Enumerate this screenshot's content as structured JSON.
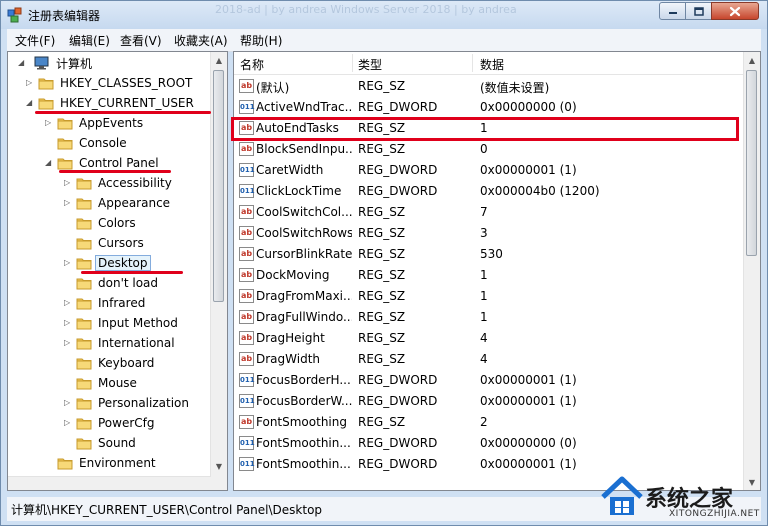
{
  "window": {
    "title": "注册表编辑器",
    "ghost_tab_text": "2018-ad | by andrea                                    Windows Server 2018 | by andrea"
  },
  "menu": [
    "文件(F)",
    "编辑(E)",
    "查看(V)",
    "收藏夹(A)",
    "帮助(H)"
  ],
  "tree": {
    "root": "计算机",
    "items": [
      {
        "label": "HKEY_CLASSES_ROOT",
        "expander": "▷"
      },
      {
        "label": "HKEY_CURRENT_USER",
        "expander": "◢"
      },
      {
        "label": "AppEvents",
        "expander": "▷"
      },
      {
        "label": "Console",
        "expander": ""
      },
      {
        "label": "Control Panel",
        "expander": "◢"
      },
      {
        "label": "Accessibility",
        "expander": "▷"
      },
      {
        "label": "Appearance",
        "expander": "▷"
      },
      {
        "label": "Colors",
        "expander": ""
      },
      {
        "label": "Cursors",
        "expander": ""
      },
      {
        "label": "Desktop",
        "expander": "▷"
      },
      {
        "label": "don't load",
        "expander": ""
      },
      {
        "label": "Infrared",
        "expander": "▷"
      },
      {
        "label": "Input Method",
        "expander": "▷"
      },
      {
        "label": "International",
        "expander": "▷"
      },
      {
        "label": "Keyboard",
        "expander": ""
      },
      {
        "label": "Mouse",
        "expander": ""
      },
      {
        "label": "Personalization",
        "expander": "▷"
      },
      {
        "label": "PowerCfg",
        "expander": "▷"
      },
      {
        "label": "Sound",
        "expander": ""
      },
      {
        "label": "Environment",
        "expander": ""
      }
    ]
  },
  "list": {
    "columns": [
      "名称",
      "类型",
      "数据"
    ],
    "rows": [
      {
        "icon": "ab",
        "name": "(默认)",
        "type": "REG_SZ",
        "data": "(数值未设置)"
      },
      {
        "icon": "dw",
        "name": "ActiveWndTrac...",
        "type": "REG_DWORD",
        "data": "0x00000000 (0)"
      },
      {
        "icon": "ab",
        "name": "AutoEndTasks",
        "type": "REG_SZ",
        "data": "1"
      },
      {
        "icon": "ab",
        "name": "BlockSendInpu...",
        "type": "REG_SZ",
        "data": "0"
      },
      {
        "icon": "dw",
        "name": "CaretWidth",
        "type": "REG_DWORD",
        "data": "0x00000001 (1)"
      },
      {
        "icon": "dw",
        "name": "ClickLockTime",
        "type": "REG_DWORD",
        "data": "0x000004b0 (1200)"
      },
      {
        "icon": "ab",
        "name": "CoolSwitchCol...",
        "type": "REG_SZ",
        "data": "7"
      },
      {
        "icon": "ab",
        "name": "CoolSwitchRows",
        "type": "REG_SZ",
        "data": "3"
      },
      {
        "icon": "ab",
        "name": "CursorBlinkRate",
        "type": "REG_SZ",
        "data": "530"
      },
      {
        "icon": "ab",
        "name": "DockMoving",
        "type": "REG_SZ",
        "data": "1"
      },
      {
        "icon": "ab",
        "name": "DragFromMaxi...",
        "type": "REG_SZ",
        "data": "1"
      },
      {
        "icon": "ab",
        "name": "DragFullWindo...",
        "type": "REG_SZ",
        "data": "1"
      },
      {
        "icon": "ab",
        "name": "DragHeight",
        "type": "REG_SZ",
        "data": "4"
      },
      {
        "icon": "ab",
        "name": "DragWidth",
        "type": "REG_SZ",
        "data": "4"
      },
      {
        "icon": "dw",
        "name": "FocusBorderH...",
        "type": "REG_DWORD",
        "data": "0x00000001 (1)"
      },
      {
        "icon": "dw",
        "name": "FocusBorderW...",
        "type": "REG_DWORD",
        "data": "0x00000001 (1)"
      },
      {
        "icon": "ab",
        "name": "FontSmoothing",
        "type": "REG_SZ",
        "data": "2"
      },
      {
        "icon": "dw",
        "name": "FontSmoothin...",
        "type": "REG_DWORD",
        "data": "0x00000000 (0)"
      },
      {
        "icon": "dw",
        "name": "FontSmoothin...",
        "type": "REG_DWORD",
        "data": "0x00000001 (1)"
      }
    ]
  },
  "status": "计算机\\HKEY_CURRENT_USER\\Control Panel\\Desktop",
  "watermark": {
    "text": "系统之家",
    "sub": "XITONGZHIJIA.NET"
  },
  "colors": {
    "annotation_red": "#e0001b",
    "folder": "#f0c85a",
    "selection": "#e5f3fb"
  }
}
